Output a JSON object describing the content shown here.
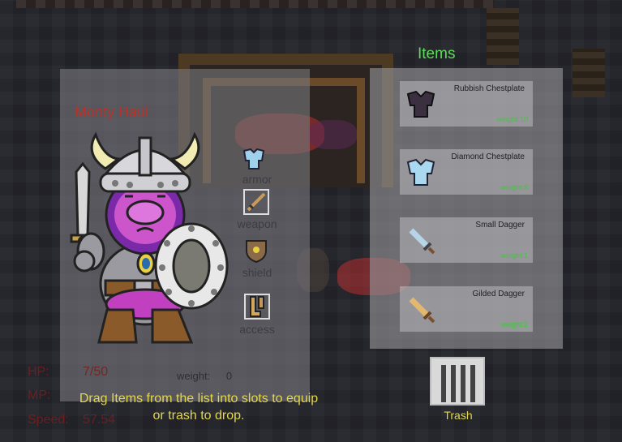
{
  "character": {
    "name": "Monty Haul",
    "slots": [
      {
        "label": "armor",
        "icon": "armor-icon"
      },
      {
        "label": "weapon",
        "icon": "weapon-icon"
      },
      {
        "label": "shield",
        "icon": "shield-icon"
      },
      {
        "label": "access",
        "icon": "accessory-icon"
      }
    ],
    "weight_label": "weight:",
    "weight_value": "0"
  },
  "stats": {
    "hp_label": "HP:",
    "hp_value": "7/50",
    "mp_label": "MP:",
    "mp_value": "",
    "speed_label": "Speed:",
    "speed_value": "57.54"
  },
  "hint": "Drag Items from the list into slots to equip or trash to drop.",
  "items_panel": {
    "title": "Items",
    "items": [
      {
        "name": "Rubbish Chestplate",
        "weight": "weight:10",
        "icon": "rubbish-chestplate-icon",
        "color": "#3a3040"
      },
      {
        "name": "Diamond Chestplate",
        "weight": "weight:8",
        "icon": "diamond-chestplate-icon",
        "color": "#a9d8f0"
      },
      {
        "name": "Small Dagger",
        "weight": "weight:1",
        "icon": "small-dagger-icon",
        "color": "#b8d4e8"
      },
      {
        "name": "Gilded Dagger",
        "weight": "weight:2",
        "icon": "gilded-dagger-icon",
        "color": "#e2b870"
      }
    ]
  },
  "trash": {
    "label": "Trash",
    "icon": "trash-bin-icon"
  },
  "colors": {
    "name": "#b4342a",
    "hint": "#e3d84a",
    "items_title": "#5fdc5a",
    "item_weight": "#3acb36"
  }
}
